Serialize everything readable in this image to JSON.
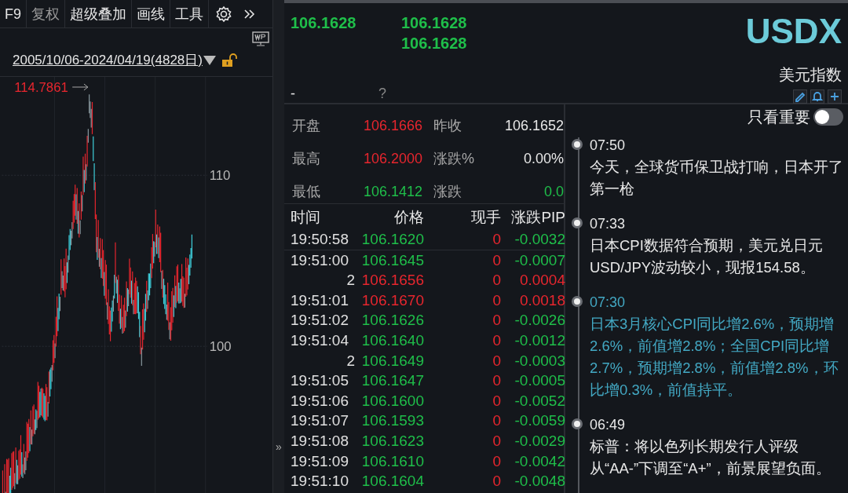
{
  "toolbar": {
    "items": [
      {
        "label": "F9",
        "disabled": false
      },
      {
        "label": "复权",
        "disabled": true
      },
      {
        "label": "超级叠加",
        "disabled": false
      },
      {
        "label": "画线",
        "disabled": false
      },
      {
        "label": "工具",
        "disabled": false
      }
    ]
  },
  "chart": {
    "date_range": "2005/10/06-2024/04/19(4828日)",
    "locked": false,
    "high_label": "114.7861",
    "axis_labels": [
      "110",
      "100"
    ]
  },
  "quote_header": {
    "prices": [
      "106.1628",
      "106.1628",
      "106.1628"
    ],
    "dash": "-",
    "question": "?",
    "symbol": "USDX",
    "name": "美元指数"
  },
  "stats": [
    {
      "label": "开盘",
      "value": "106.1666",
      "color": "#e8262e"
    },
    {
      "label": "昨收",
      "value": "106.1652",
      "color": "#e8e8e8"
    },
    {
      "label": "最高",
      "value": "106.2000",
      "color": "#e8262e"
    },
    {
      "label": "涨跌%",
      "value": "0.00%",
      "color": "#e8e8e8"
    },
    {
      "label": "最低",
      "value": "106.1412",
      "color": "#1fbf4a"
    },
    {
      "label": "涨跌",
      "value": "0.0",
      "color": "#1fbf4a"
    }
  ],
  "ticks": {
    "columns": [
      "时间",
      "价格",
      "现手",
      "涨跌PIP"
    ],
    "rows": [
      {
        "time": "19:50:58",
        "price": "106.1620",
        "volume": "0",
        "change": "-0.0032",
        "color": "#1fbf4a"
      },
      {
        "time": "19:51:00",
        "price": "106.1645",
        "volume": "0",
        "change": "-0.0007",
        "color": "#1fbf4a"
      },
      {
        "time": "2",
        "price": "106.1656",
        "volume": "0",
        "change": "0.0004",
        "color": "#e8262e"
      },
      {
        "time": "19:51:01",
        "price": "106.1670",
        "volume": "0",
        "change": "0.0018",
        "color": "#e8262e"
      },
      {
        "time": "19:51:02",
        "price": "106.1626",
        "volume": "0",
        "change": "-0.0026",
        "color": "#1fbf4a"
      },
      {
        "time": "19:51:04",
        "price": "106.1640",
        "volume": "0",
        "change": "-0.0012",
        "color": "#1fbf4a"
      },
      {
        "time": "2",
        "price": "106.1649",
        "volume": "0",
        "change": "-0.0003",
        "color": "#1fbf4a"
      },
      {
        "time": "19:51:05",
        "price": "106.1647",
        "volume": "0",
        "change": "-0.0005",
        "color": "#1fbf4a"
      },
      {
        "time": "19:51:06",
        "price": "106.1600",
        "volume": "0",
        "change": "-0.0052",
        "color": "#1fbf4a"
      },
      {
        "time": "19:51:07",
        "price": "106.1593",
        "volume": "0",
        "change": "-0.0059",
        "color": "#1fbf4a"
      },
      {
        "time": "19:51:08",
        "price": "106.1623",
        "volume": "0",
        "change": "-0.0029",
        "color": "#1fbf4a"
      },
      {
        "time": "19:51:09",
        "price": "106.1610",
        "volume": "0",
        "change": "-0.0042",
        "color": "#1fbf4a"
      },
      {
        "time": "19:51:10",
        "price": "106.1604",
        "volume": "0",
        "change": "-0.0048",
        "color": "#1fbf4a"
      }
    ]
  },
  "news": {
    "filter_label": "只看重要",
    "filter_on": false,
    "items": [
      {
        "time": "07:50",
        "text": "今天，全球货币保卫战打响，日本开了第一枪",
        "highlighted": false
      },
      {
        "time": "07:33",
        "text": "日本CPI数据符合预期，美元兑日元USD/JPY波动较小，现报154.58。",
        "highlighted": false
      },
      {
        "time": "07:30",
        "text": "日本3月核心CPI同比增2.6%，预期增2.6%，前值增2.8%；全国CPI同比增2.7%，预期增2.8%，前值增2.8%，环比增0.3%，前值持平。",
        "highlighted": true
      },
      {
        "time": "06:49",
        "text": "标普：将以色列长期发行人评级从“AA-”下调至“A+”，前景展望负面。",
        "highlighted": false
      }
    ]
  },
  "divider": {
    "expand": "»"
  }
}
